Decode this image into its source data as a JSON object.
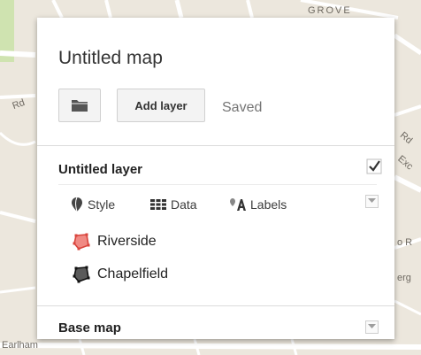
{
  "map_labels": {
    "grove": "GROVE",
    "earlham": "Earlham",
    "left_road": "Rd",
    "right_1": "Rd",
    "right_2": "Exc",
    "right_3": "o R",
    "right_4": "erg"
  },
  "panel": {
    "map_title": "Untitled map",
    "add_layer_label": "Add layer",
    "save_status": "Saved"
  },
  "layer": {
    "title": "Untitled layer",
    "checked": true,
    "tools": {
      "style": "Style",
      "data": "Data",
      "labels": "Labels"
    },
    "features": [
      {
        "name": "Riverside",
        "icon": "polygon-icon",
        "color": "#e8605a"
      },
      {
        "name": "Chapelfield",
        "icon": "polygon-icon",
        "color": "#1a1a1a"
      }
    ]
  },
  "base_map": {
    "title": "Base map"
  },
  "icons": {
    "folder": "folder-icon",
    "checkbox": "checkmark-icon",
    "dropdown": "chevron-down-icon",
    "style": "paint-bucket-icon",
    "data": "table-grid-icon",
    "labels": "label-a-icon"
  }
}
